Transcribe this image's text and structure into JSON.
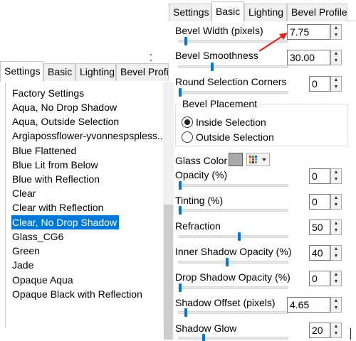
{
  "left_tabs": [
    "Settings",
    "Basic",
    "Lighting",
    "Bevel Profil"
  ],
  "presets": [
    "Factory Settings",
    "Aqua, No Drop Shadow",
    "Aqua, Outside Selection",
    "Argiapossflower-yvonnespspless...",
    "Blue Flattened",
    "Blue Lit from Below",
    "Blue with Reflection",
    "Clear",
    "Clear with Reflection",
    "Clear, No Drop Shadow",
    "Glass_CG6",
    "Green",
    "Jade",
    "Opaque Aqua",
    "Opaque Black with Reflection"
  ],
  "selected_preset": "Clear, No Drop Shadow",
  "right_tabs": [
    "Settings",
    "Basic",
    "Lighting",
    "Bevel Profile"
  ],
  "active_right_tab": "Basic",
  "controls": {
    "bevel_width": {
      "label": "Bevel Width (pixels)",
      "value": "7.75",
      "level": 0.05
    },
    "bevel_smoothness": {
      "label": "Bevel Smoothness",
      "value": "30.00",
      "level": 0.3
    },
    "round_corners": {
      "label": "Round Selection Corners",
      "value": "0",
      "level": 0.0
    },
    "opacity": {
      "label": "Opacity (%)",
      "value": "0",
      "level": 0.0
    },
    "tinting": {
      "label": "Tinting (%)",
      "value": "0",
      "level": 0.0
    },
    "refraction": {
      "label": "Refraction",
      "value": "50",
      "level": 0.55
    },
    "inner_shadow": {
      "label": "Inner Shadow Opacity (%)",
      "value": "40",
      "level": 0.44
    },
    "drop_shadow": {
      "label": "Drop Shadow Opacity (%)",
      "value": "0",
      "level": 0.0
    },
    "shadow_offset": {
      "label": "Shadow Offset (pixels)",
      "value": "4.65",
      "level": 0.05
    },
    "shadow_glow": {
      "label": "Shadow Glow",
      "value": "20",
      "level": 0.22
    }
  },
  "bevel_placement": {
    "title": "Bevel Placement",
    "inside": "Inside Selection",
    "outside": "Outside Selection",
    "selected": "inside"
  },
  "glass_color": {
    "label": "Glass Color",
    "swatch": "#aaaaaa"
  },
  "colors": {
    "accent": "#0078d7",
    "annotation_arrow": "#e8201c"
  }
}
